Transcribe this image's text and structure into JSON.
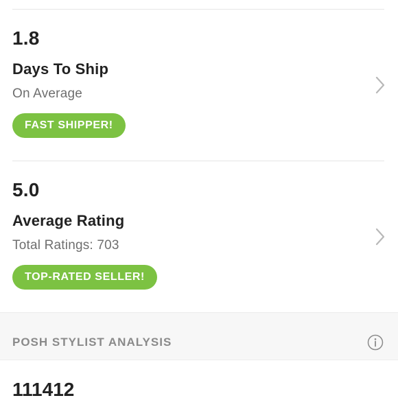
{
  "ship_card": {
    "value": "1.8",
    "label": "Days To Ship",
    "sub": "On Average",
    "badge": "FAST SHIPPER!"
  },
  "rating_card": {
    "value": "5.0",
    "label": "Average Rating",
    "sub": "Total Ratings: 703",
    "badge": "TOP-RATED SELLER!"
  },
  "stylist_section": {
    "title": "POSH STYLIST ANALYSIS",
    "info_icon": "info-icon",
    "value": "111412"
  },
  "colors": {
    "badge_green": "#7cc242",
    "text_dark": "#222222",
    "text_muted": "#6e6e6e",
    "section_bg": "#f7f7f7"
  },
  "icons": {
    "row_action": "chevron-right-icon"
  }
}
